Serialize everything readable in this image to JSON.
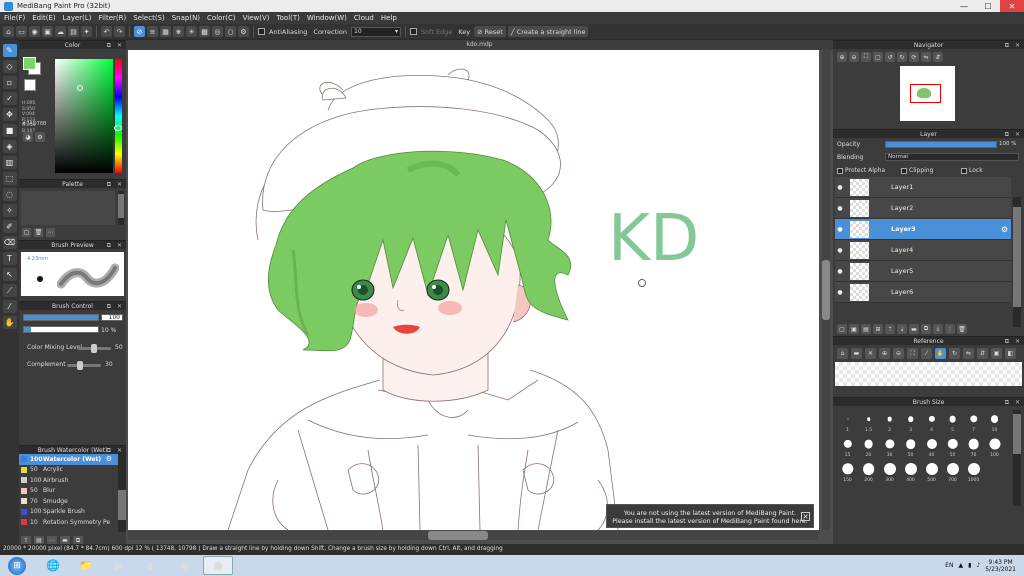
{
  "window": {
    "title": "MediBang Paint Pro (32bit)",
    "minimize": "—",
    "maximize": "☐",
    "close": "✕"
  },
  "menu": [
    "File(F)",
    "Edit(E)",
    "Layer(L)",
    "Filter(R)",
    "Select(S)",
    "Snap(N)",
    "Color(C)",
    "View(V)",
    "Tool(T)",
    "Window(W)",
    "Cloud",
    "Help"
  ],
  "toolbar": {
    "antialiasing": "AntiAliasing",
    "correction_label": "Correction",
    "correction_value": "10",
    "soft_edge": "Soft Edge",
    "key": "Key",
    "reset": "Reset",
    "straight_line": "Create a straight line"
  },
  "panels": {
    "color": "Color",
    "palette": "Palette",
    "brush_preview": "Brush Preview",
    "brush_control": "Brush Control",
    "brush_list": "Brush Watercolor (Wet)",
    "navigator": "Navigator",
    "layer": "Layer",
    "reference": "Reference",
    "brush_size": "Brush Size",
    "panel_buttons": "⧉ ✕"
  },
  "color": {
    "foreground": "#7BD56B",
    "values": [
      "H:095",
      "S:050",
      "V:094",
      "R:123",
      "G:213",
      "B:107"
    ],
    "hex": "#7AD76B"
  },
  "brush_preview": {
    "size": "4.23mm"
  },
  "brush_control": {
    "size_value": "100",
    "opacity_value": "10 %",
    "size_fraction": 1.0,
    "opacity_fraction": 0.1,
    "mixing_label": "Color Mixing Level",
    "mixing_value": "50",
    "complement_label": "Complement",
    "complement_value": "30"
  },
  "brushes": [
    {
      "size": "100",
      "name": "Watercolor (Wet)",
      "color": "#3d7fd0",
      "selected": true
    },
    {
      "size": "50",
      "name": "Acrylic",
      "color": "#e8d640",
      "selected": false
    },
    {
      "size": "100",
      "name": "Airbrush",
      "color": "#cfcfcf",
      "selected": false
    },
    {
      "size": "50",
      "name": "Blur",
      "color": "#f2c4c4",
      "selected": false
    },
    {
      "size": "70",
      "name": "Smudge",
      "color": "#e8e0c8",
      "selected": false
    },
    {
      "size": "100",
      "name": "Sparkle Brush",
      "color": "#3d4ed8",
      "selected": false
    },
    {
      "size": "10",
      "name": "Rotation Symmetry Pe",
      "color": "#d83d3d",
      "selected": false
    }
  ],
  "document": {
    "tab": "kdo.mdp",
    "canvas_text": "KD",
    "notice_line1": "You are not using the latest version of MediBang Paint.",
    "notice_line2": "Please install the latest version of MediBang Paint found here.",
    "notice_close": "✕"
  },
  "layer": {
    "opacity_label": "Opacity",
    "opacity_value": "100 %",
    "blending_label": "Blending",
    "blending_value": "Normal",
    "protect_alpha": "Protect Alpha",
    "clipping": "Clipping",
    "lock": "Lock",
    "layers": [
      {
        "name": "Layer1",
        "selected": false
      },
      {
        "name": "Layer2",
        "selected": false
      },
      {
        "name": "Layer3",
        "selected": true
      },
      {
        "name": "Layer4",
        "selected": false
      },
      {
        "name": "Layer5",
        "selected": false
      },
      {
        "name": "Layer6",
        "selected": false
      }
    ]
  },
  "brush_sizes": [
    "1",
    "1.5",
    "2",
    "3",
    "4",
    "5",
    "7",
    "10",
    "15",
    "20",
    "30",
    "50",
    "40",
    "50",
    "70",
    "100",
    "150",
    "200",
    "300",
    "400",
    "500",
    "700",
    "1000"
  ],
  "status": {
    "text": "20000 * 20000 pixel  (84.7 * 84.7cm)  600 dpi  12 %  ( 13748, 10798 )  Draw a straight line by holding down Shift, Change a brush size by holding down Ctrl, Alt, and dragging"
  },
  "taskbar": {
    "language": "EN",
    "time": "9:43 PM",
    "date": "5/23/2021"
  }
}
